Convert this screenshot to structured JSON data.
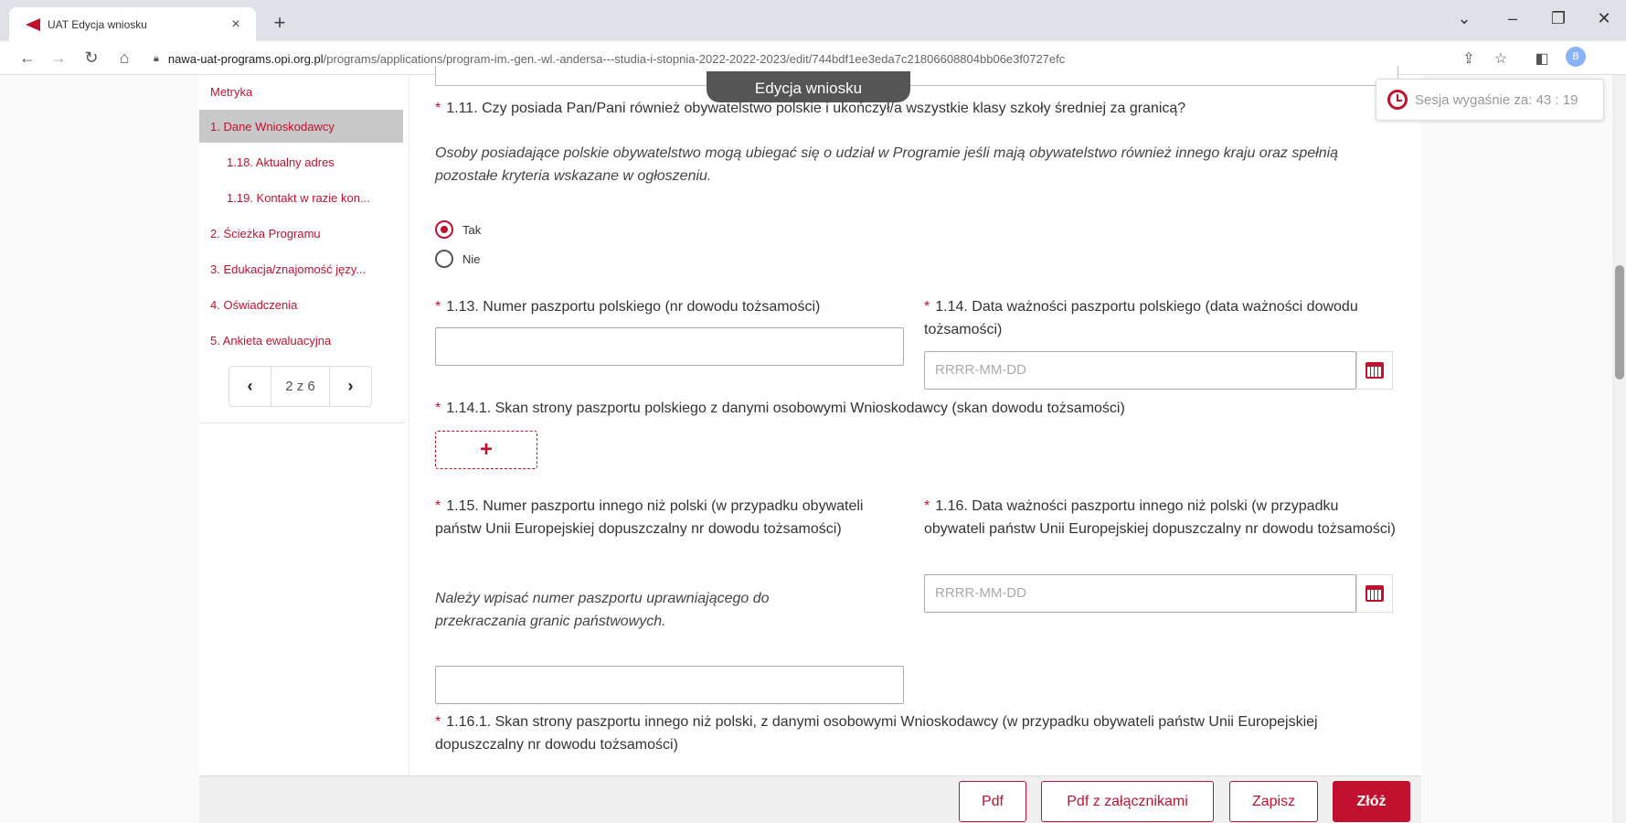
{
  "browser": {
    "tab_title": "UAT Edycja wniosku",
    "tab_close": "×",
    "new_tab": "+",
    "url_host": "nawa-uat-programs.opi.org.pl",
    "url_path": "/programs/applications/program-im.-gen.-wl.-andersa---studia-i-stopnia-2022-2022-2023/edit/744bdf1ee3eda7c21806608804bb06e3f0727efc",
    "profile_initial": "B"
  },
  "header": {
    "title": "Edycja wniosku",
    "session_text": "Sesja wygaśnie za: 43 : 19"
  },
  "sidebar": {
    "items": [
      {
        "label": "Metryka"
      },
      {
        "label": "1. Dane Wnioskodawcy"
      },
      {
        "label": "1.18. Aktualny adres"
      },
      {
        "label": "1.19. Kontakt w razie kon..."
      },
      {
        "label": "2. Ścieżka Programu"
      },
      {
        "label": "3. Edukacja/znajomość języ..."
      },
      {
        "label": "4. Oświadczenia"
      },
      {
        "label": "5. Ankieta ewaluacyjna"
      }
    ],
    "pager": {
      "text": "2 z 6"
    }
  },
  "form": {
    "q111": {
      "label": "1.11. Czy posiada Pan/Pani również obywatelstwo polskie i ukończył/a wszystkie klasy szkoły średniej za granicą?",
      "hint": "Osoby posiadające polskie obywatelstwo mogą ubiegać się o udział w Programie jeśli mają obywatelstwo również innego kraju oraz spełnią pozostałe kryteria wskazane w ogłoszeniu.",
      "options": [
        "Tak",
        "Nie"
      ],
      "selected": "Tak"
    },
    "q113": {
      "label": "1.13. Numer paszportu polskiego (nr dowodu tożsamości)",
      "value": ""
    },
    "q114": {
      "label": "1.14. Data ważności paszportu polskiego (data ważności dowodu tożsamości)",
      "placeholder": "RRRR-MM-DD"
    },
    "q1141": {
      "label": "1.14.1. Skan strony paszportu polskiego z danymi osobowymi Wnioskodawcy (skan dowodu tożsamości)",
      "add": "+"
    },
    "q115": {
      "label": "1.15. Numer paszportu innego niż polski (w przypadku obywateli państw Unii Europejskiej dopuszczalny nr dowodu tożsamości)",
      "hint": "Należy wpisać numer paszportu uprawniającego do przekraczania granic państwowych.",
      "value": ""
    },
    "q116": {
      "label": "1.16. Data ważności paszportu innego niż polski (w przypadku obywateli państw Unii Europejskiej dopuszczalny nr dowodu tożsamości)",
      "placeholder": "RRRR-MM-DD"
    },
    "q1161": {
      "label": "1.16.1. Skan strony paszportu innego niż polski, z danymi osobowymi Wnioskodawcy (w przypadku obywateli państw Unii Europejskiej dopuszczalny nr dowodu tożsamości)"
    }
  },
  "footer": {
    "pdf": "Pdf",
    "pdf_attachments": "Pdf z załącznikami",
    "save": "Zapisz",
    "submit": "Złóż"
  },
  "colors": {
    "accent": "#c0122f",
    "active_nav_bg": "#c8c8c8"
  },
  "icons": [
    "back-arrow-icon",
    "forward-arrow-icon",
    "reload-icon",
    "home-icon",
    "lock-icon",
    "share-icon",
    "star-icon",
    "sidebar-icon",
    "clock-icon",
    "calendar-icon",
    "chevron-left-icon",
    "chevron-right-icon",
    "plus-icon"
  ]
}
